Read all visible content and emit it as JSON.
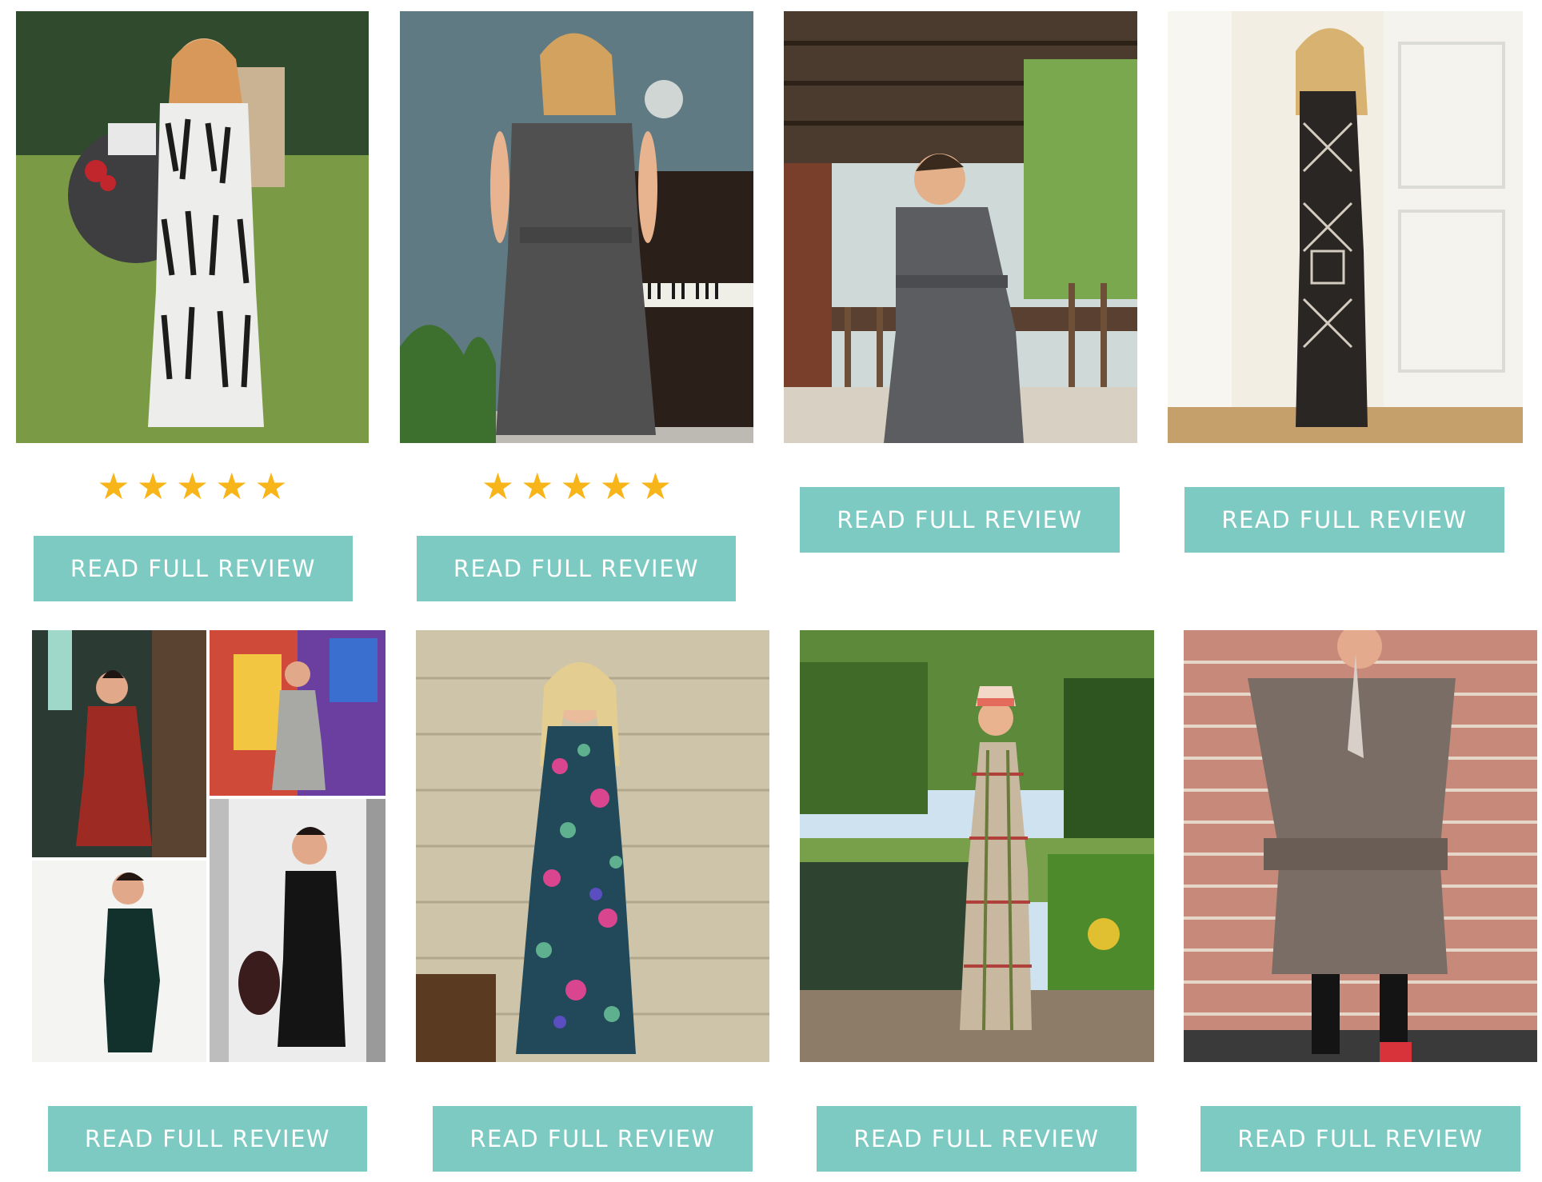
{
  "colors": {
    "accent": "#7ccac2",
    "star": "#f8b51a",
    "button_text": "#ffffff"
  },
  "icons": {
    "star": "star-icon"
  },
  "cards": [
    {
      "name": "review-card-1",
      "rating": 5,
      "button_label": "READ FULL REVIEW",
      "photo": "woman-in-black-white-print-maxi-dress-on-lawn"
    },
    {
      "name": "review-card-2",
      "rating": 5,
      "button_label": "READ FULL REVIEW",
      "photo": "woman-in-grey-sleeveless-dress-by-piano"
    },
    {
      "name": "review-card-3",
      "button_label": "READ FULL REVIEW",
      "photo": "woman-in-grey-long-sleeve-dress-on-porch"
    },
    {
      "name": "review-card-4",
      "button_label": "READ FULL REVIEW",
      "photo": "woman-in-geometric-print-maxi-dress-by-door"
    },
    {
      "name": "review-card-5",
      "button_label": "READ FULL REVIEW",
      "photo": "collage-of-four-dress-photos"
    },
    {
      "name": "review-card-6",
      "button_label": "READ FULL REVIEW",
      "photo": "woman-in-floral-maxi-dress-by-stone-wall"
    },
    {
      "name": "review-card-7",
      "button_label": "READ FULL REVIEW",
      "photo": "woman-in-plaid-maxi-dress-by-pond"
    },
    {
      "name": "review-card-8",
      "button_label": "READ FULL REVIEW",
      "photo": "woman-in-grey-dress-by-brick-wall"
    }
  ]
}
